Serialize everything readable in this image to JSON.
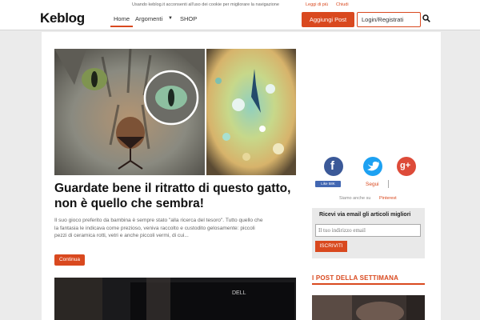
{
  "cookie_bar": {
    "text": "Usando keblog.it acconsenti all'uso dei cookie per migliorare la navigazione",
    "more_link": "Leggi di più",
    "close_link": "Chiudi"
  },
  "header": {
    "logo": "Keblog",
    "nav": [
      "Home",
      "Argomenti",
      "SHOP"
    ],
    "add_post": "Aggiungi Post",
    "login": "Login/Registrati"
  },
  "article": {
    "title": "Guardate bene il ritratto di questo gatto, non è quello che sembra!",
    "excerpt": "Il suo gioco preferito da bambina è sempre stato \"alla ricerca del tesoro\". Tutto quello che la fantasia le indicava come prezioso, veniva raccolto e custodito gelosamente: piccoli pezzi di ceramica rotti, vetri e anche piccoli vermi, di cui...",
    "continue_label": "Continua",
    "second_image_brand": "DELL"
  },
  "sidebar": {
    "social": [
      {
        "name": "facebook",
        "glyph": "f",
        "color": "#3b5998"
      },
      {
        "name": "twitter",
        "glyph": "t",
        "color": "#1da1f2"
      },
      {
        "name": "googleplus",
        "glyph": "g+",
        "color": "#dd4b39"
      }
    ],
    "fb_like": "Like 58K",
    "segui": "Segui",
    "siamo_anche": "Siamo anche su",
    "pinterest": "Pinterest",
    "email_title": "Ricevi via email gli articoli migliori",
    "email_placeholder": "Il tuo indirizzo email",
    "subscribe": "ISCRIVITI",
    "week_title": "I POST DELLA SETTIMANA"
  },
  "colors": {
    "accent": "#d9491f",
    "background": "#ebebeb"
  }
}
